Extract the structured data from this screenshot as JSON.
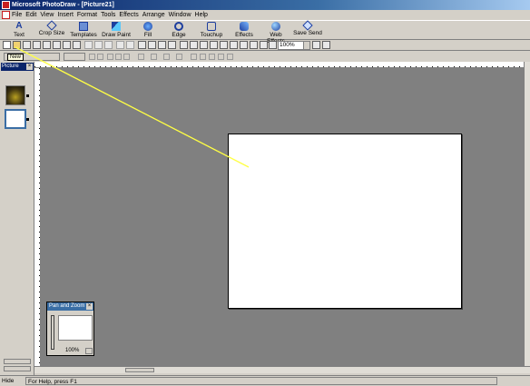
{
  "window": {
    "title": "Microsoft PhotoDraw - [Picture21]"
  },
  "menu": [
    "File",
    "Edit",
    "View",
    "Insert",
    "Format",
    "Tools",
    "Effects",
    "Arrange",
    "Window",
    "Help"
  ],
  "visual_menu": [
    {
      "label": "Text",
      "icon": "text-icon"
    },
    {
      "label": "Crop Size",
      "icon": "crop-icon"
    },
    {
      "label": "Templates",
      "icon": "templates-icon"
    },
    {
      "label": "Draw Paint",
      "icon": "draw-paint-icon"
    },
    {
      "label": "Fill",
      "icon": "fill-icon"
    },
    {
      "label": "Edge",
      "icon": "edge-icon"
    },
    {
      "label": "Touchup",
      "icon": "touchup-icon"
    },
    {
      "label": "Effects",
      "icon": "effects-icon"
    },
    {
      "label": "Web Effects",
      "icon": "web-effects-icon"
    },
    {
      "label": "Save Send",
      "icon": "save-send-icon"
    }
  ],
  "toolbar": {
    "zoom": "100%"
  },
  "tooltip": "New",
  "picture_list": {
    "title": "Picture"
  },
  "pan_zoom": {
    "title": "Pan and Zoom",
    "zoom": "100%"
  },
  "status": {
    "hide_label": "Hide",
    "help_text": "For Help, press F1"
  },
  "colors": {
    "title_active": "#0a246a",
    "workspace": "#808080",
    "pointer_line": "#ffff44"
  }
}
